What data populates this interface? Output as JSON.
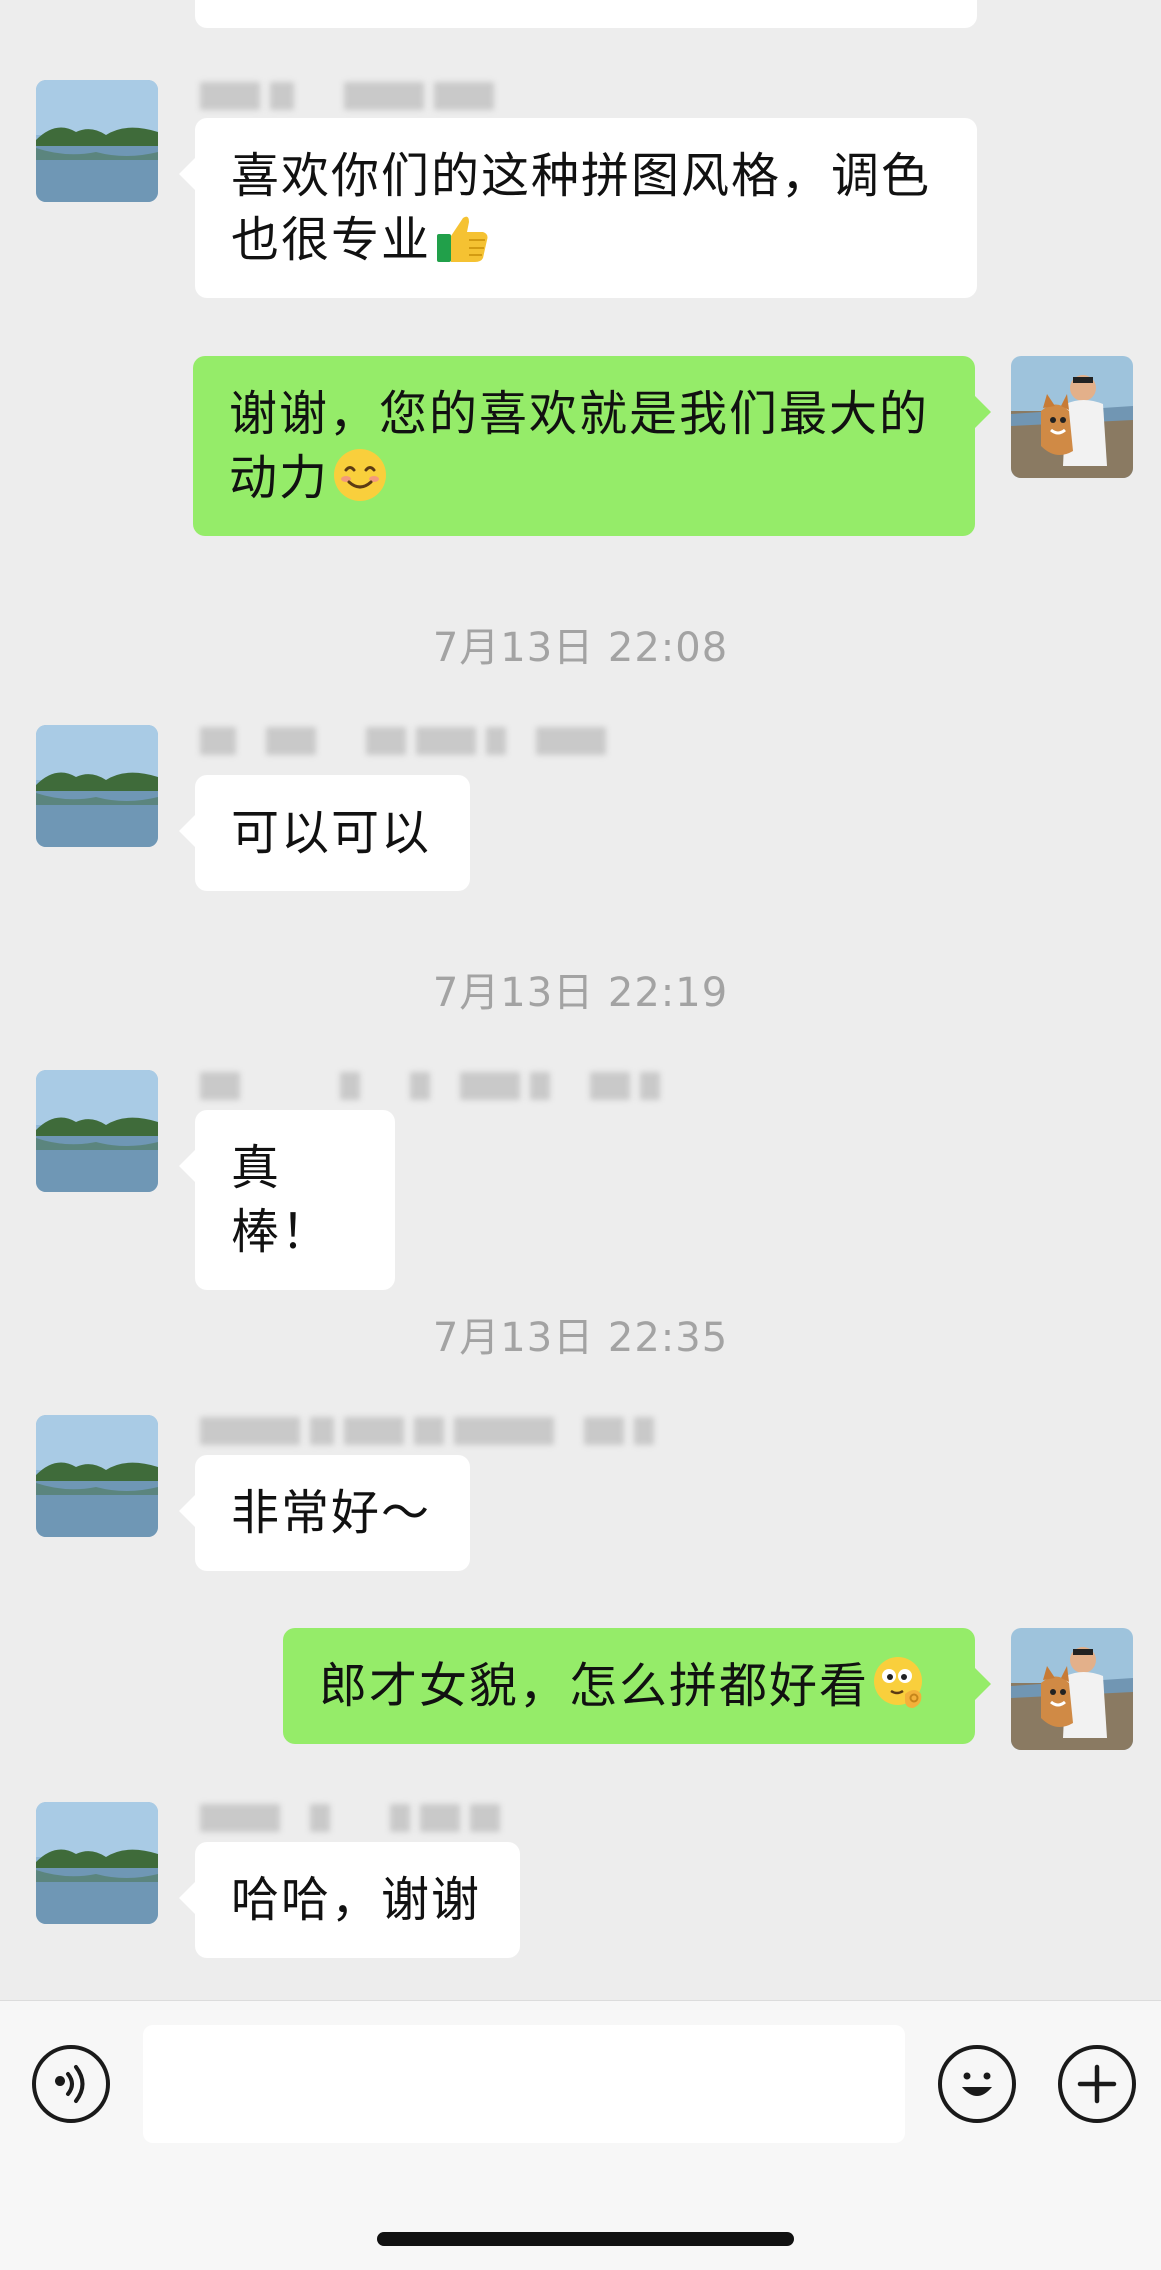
{
  "messages": [
    {
      "direction": "in",
      "text": "喜欢你们的这种拼图风格，调色也很专业",
      "emoji": "thumbs-up"
    },
    {
      "direction": "out",
      "text": "谢谢，您的喜欢就是我们最大的动力",
      "emoji": "smiling-face"
    },
    {
      "direction": "in",
      "text": "可以可以"
    },
    {
      "direction": "in",
      "text": "真棒！"
    },
    {
      "direction": "in",
      "text": "非常好～"
    },
    {
      "direction": "out",
      "text": "郎才女貌，怎么拼都好看",
      "emoji": "ok-hand-face"
    },
    {
      "direction": "in",
      "text": "哈哈，谢谢"
    }
  ],
  "timestamps": [
    "7月13日 22:08",
    "7月13日 22:19",
    "7月13日 22:35"
  ],
  "input_bar": {
    "voice_icon": "voice-icon",
    "emoji_icon": "emoji-icon",
    "plus_icon": "plus-icon",
    "placeholder": ""
  },
  "colors": {
    "background": "#ededed",
    "incoming_bubble": "#ffffff",
    "outgoing_bubble": "#95ec69",
    "timestamp_text": "#a3a3a3"
  }
}
